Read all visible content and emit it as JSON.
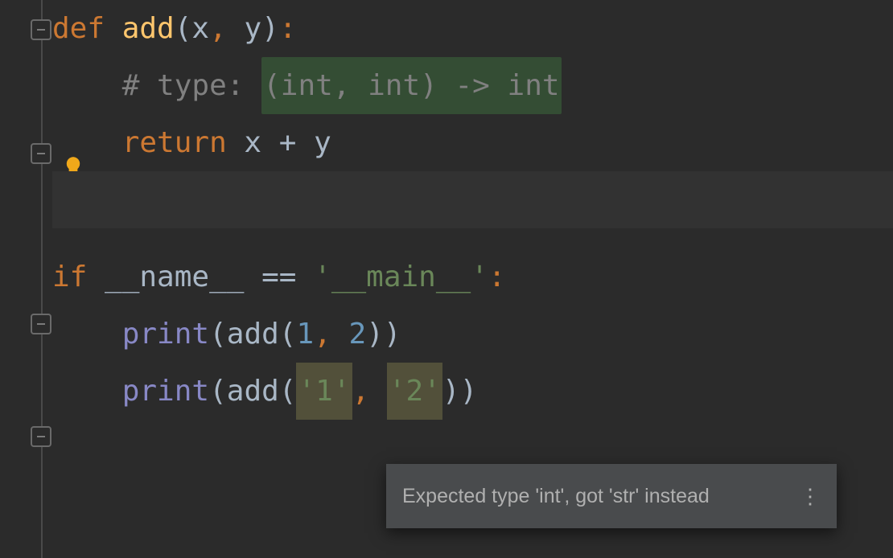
{
  "code": {
    "line1": {
      "kw": "def ",
      "fn": "add",
      "lp": "(",
      "p1": "x",
      "c": ", ",
      "p2": "y",
      "rp": ")",
      "coln": ":"
    },
    "line2": {
      "indent": "    ",
      "cmt_hash": "# type: ",
      "hint": "(int, int) -> int"
    },
    "line3": {
      "indent": "    ",
      "kw": "return ",
      "expr": "x + y"
    },
    "line5": {
      "kw": "if ",
      "name": "__name__ ",
      "eq": "== ",
      "str": "'__main__'",
      "coln": ":"
    },
    "line6": {
      "indent": "    ",
      "print": "print",
      "lp": "(",
      "add": "add",
      "lp2": "(",
      "n1": "1",
      "c": ", ",
      "n2": "2",
      "rp2": ")",
      "rp": ")"
    },
    "line7": {
      "indent": "    ",
      "print": "print",
      "lp": "(",
      "add": "add",
      "lp2": "(",
      "s1": "'1'",
      "c": ", ",
      "s2": "'2'",
      "rp2": ")",
      "rp": ")"
    }
  },
  "tooltip": {
    "text": "Expected type 'int', got 'str' instead"
  }
}
